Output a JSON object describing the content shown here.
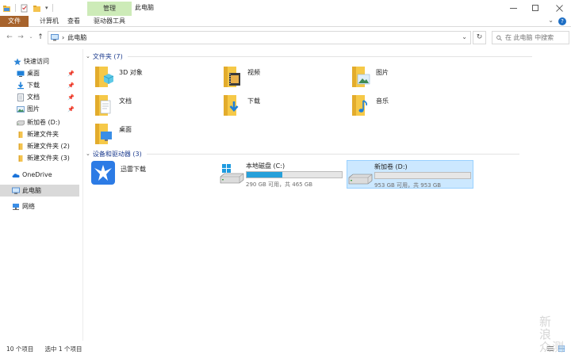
{
  "window": {
    "title": "此电脑",
    "context_tab": "管理",
    "controls": [
      "minimize",
      "maximize",
      "close"
    ]
  },
  "ribbon": {
    "tabs": [
      "文件",
      "计算机",
      "查看",
      "驱动器工具"
    ],
    "help": "?"
  },
  "address": {
    "path": "此电脑",
    "search_placeholder": "在 此电脑 中搜索"
  },
  "sidebar": {
    "quick_access": "快速访问",
    "pinned": [
      {
        "label": "桌面",
        "icon": "desktop-icon"
      },
      {
        "label": "下载",
        "icon": "download-icon"
      },
      {
        "label": "文档",
        "icon": "document-icon"
      },
      {
        "label": "图片",
        "icon": "picture-icon"
      }
    ],
    "other": [
      {
        "label": "新加卷 (D:)",
        "icon": "drive-icon"
      },
      {
        "label": "新建文件夹",
        "icon": "folder-icon"
      },
      {
        "label": "新建文件夹 (2)",
        "icon": "folder-icon"
      },
      {
        "label": "新建文件夹 (3)",
        "icon": "folder-icon"
      }
    ],
    "onedrive": "OneDrive",
    "this_pc": "此电脑",
    "network": "网络"
  },
  "main": {
    "folders_header": "文件夹 (7)",
    "folders": [
      {
        "label": "3D 对象",
        "icon": "3d-objects-icon"
      },
      {
        "label": "视频",
        "icon": "video-folder-icon"
      },
      {
        "label": "图片",
        "icon": "pictures-folder-icon"
      },
      {
        "label": "文档",
        "icon": "documents-folder-icon"
      },
      {
        "label": "下载",
        "icon": "downloads-folder-icon"
      },
      {
        "label": "音乐",
        "icon": "music-folder-icon"
      },
      {
        "label": "桌面",
        "icon": "desktop-folder-icon"
      }
    ],
    "devices_header": "设备和驱动器 (3)",
    "devices": [
      {
        "label": "迅雷下载",
        "icon": "xunlei-icon"
      },
      {
        "label": "本地磁盘 (C:)",
        "icon": "windows-drive-icon",
        "size": "290 GB 可用，共 465 GB",
        "used_fraction": 0.376
      },
      {
        "label": "新加卷 (D:)",
        "icon": "hard-drive-icon",
        "size": "953 GB 可用，共 953 GB",
        "used_fraction": 0.0
      }
    ]
  },
  "status": {
    "items": "10 个项目",
    "selected": "选中 1 个项目"
  },
  "watermark": "新\n浪\n众测",
  "colors": {
    "accent": "#26a0da",
    "file_tab": "#a7632c",
    "context_tab": "#cdebb8",
    "selection": "#cce8ff",
    "group_header": "#1e3d8f"
  }
}
